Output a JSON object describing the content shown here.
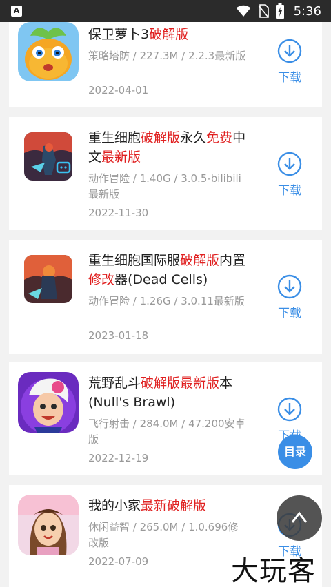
{
  "status_bar": {
    "time": "5:36",
    "left_icon_letter": "A",
    "icons": [
      "wifi-icon",
      "no-sim-icon",
      "battery-charging-icon"
    ]
  },
  "apps": [
    {
      "title_parts": [
        {
          "t": "保卫萝卜3",
          "hl": false
        },
        {
          "t": "破解版",
          "hl": true
        }
      ],
      "meta": "策略塔防 / 227.3M / 2.2.3最新版",
      "date": "2022-04-01",
      "download_label": "下载",
      "icon": "carrot-game-icon"
    },
    {
      "title_parts": [
        {
          "t": "重生细胞",
          "hl": false
        },
        {
          "t": "破解版",
          "hl": true
        },
        {
          "t": "永久",
          "hl": false
        },
        {
          "t": "免费",
          "hl": true
        },
        {
          "t": "中文",
          "hl": false
        },
        {
          "t": "最新版",
          "hl": true
        }
      ],
      "meta": "动作冒险 / 1.40G / 3.0.5-bilibili最新版",
      "date": "2022-11-30",
      "download_label": "下载",
      "icon": "dead-cells-bilibili-icon"
    },
    {
      "title_parts": [
        {
          "t": "重生细胞国际服",
          "hl": false
        },
        {
          "t": "破解版",
          "hl": true
        },
        {
          "t": "内置",
          "hl": false
        },
        {
          "t": "修改",
          "hl": true
        },
        {
          "t": "器(Dead Cells)",
          "hl": false
        }
      ],
      "meta": "动作冒险 / 1.26G / 3.0.11最新版",
      "date": "2023-01-18",
      "download_label": "下载",
      "icon": "dead-cells-icon"
    },
    {
      "title_parts": [
        {
          "t": "荒野乱斗",
          "hl": false
        },
        {
          "t": "破解版最新版",
          "hl": true
        },
        {
          "t": "本(Null's Brawl)",
          "hl": false
        }
      ],
      "meta": "飞行射击 / 284.0M / 47.200安卓版",
      "date": "2022-12-19",
      "download_label": "下载",
      "icon": "nulls-brawl-icon"
    },
    {
      "title_parts": [
        {
          "t": "我的小家",
          "hl": false
        },
        {
          "t": "最新破解版",
          "hl": true
        }
      ],
      "meta": "休闲益智 / 265.0M / 1.0.696修改版",
      "date": "2022-07-09",
      "download_label": "下载",
      "icon": "my-home-game-icon"
    }
  ],
  "toc_button_label": "目录",
  "back_to_top_icon": "chevron-up-icon",
  "watermark": "大玩客",
  "colors": {
    "accent": "#3a8ee6",
    "highlight": "#e02020",
    "meta_text": "#999999"
  }
}
